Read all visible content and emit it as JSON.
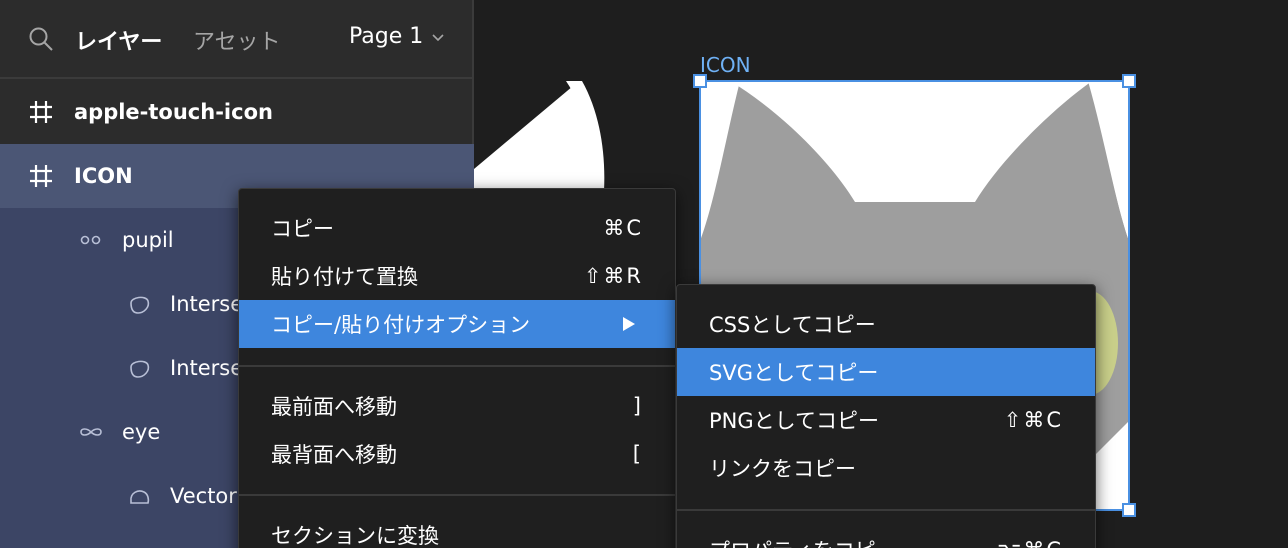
{
  "layers_panel": {
    "tabs": {
      "layers": "レイヤー",
      "assets": "アセット"
    },
    "page": "Page 1",
    "rows": [
      {
        "label": "apple-touch-icon",
        "icon": "frame-icon"
      },
      {
        "label": "ICON",
        "icon": "frame-icon"
      },
      {
        "label": "pupil",
        "icon": "group-icon"
      },
      {
        "label": "Interse",
        "icon": "boolean-icon"
      },
      {
        "label": "Interse",
        "icon": "boolean-icon"
      },
      {
        "label": "eye",
        "icon": "group-icon"
      },
      {
        "label": "Vector",
        "icon": "vector-icon"
      }
    ]
  },
  "canvas": {
    "frame_label": "ICON"
  },
  "context_menu": {
    "items": [
      {
        "label": "コピー",
        "shortcut": "⌘C"
      },
      {
        "label": "貼り付けて置換",
        "shortcut": "⇧⌘R"
      },
      {
        "label": "コピー/貼り付けオプション",
        "shortcut": ""
      },
      {
        "label": "最前面へ移動",
        "shortcut": "]"
      },
      {
        "label": "最背面へ移動",
        "shortcut": "["
      },
      {
        "label": "セクションに変換",
        "shortcut": ""
      }
    ]
  },
  "submenu": {
    "items": [
      {
        "label": "CSSとしてコピー",
        "shortcut": ""
      },
      {
        "label": "SVGとしてコピー",
        "shortcut": ""
      },
      {
        "label": "PNGとしてコピー",
        "shortcut": "⇧⌘C"
      },
      {
        "label": "リンクをコピー",
        "shortcut": ""
      },
      {
        "label": "プロパティをコピー",
        "shortcut": "⌥⌘C"
      }
    ]
  },
  "colors": {
    "panel_bg": "#2c2c2c",
    "canvas_bg": "#1e1e1e",
    "selection_row": "#4b5675",
    "child_rows": "#3c4565",
    "accent": "#3e86dd",
    "frame_label": "#6fb1f5",
    "cat_gray": "#9e9e9e"
  }
}
